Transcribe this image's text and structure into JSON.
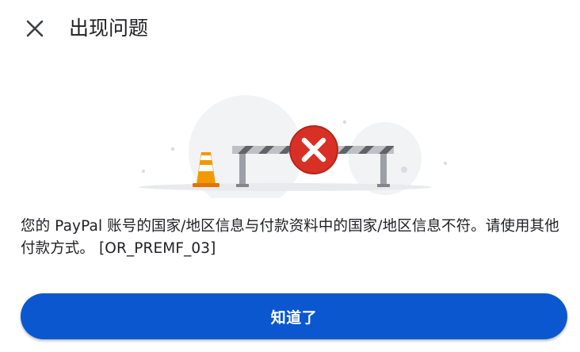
{
  "dialog": {
    "title": "出现问题",
    "close_icon": "close-icon",
    "illustration_icon": "error-barrier-illustration",
    "message": "您的 PayPal 账号的国家/地区信息与付款资料中的国家/地区信息不符。请使用其他付款方式。 [OR_PREMF_03]",
    "confirm_label": "知道了"
  },
  "colors": {
    "accent": "#0b57d0",
    "error": "#d93025",
    "cone": "#f29900",
    "text": "#202124"
  }
}
